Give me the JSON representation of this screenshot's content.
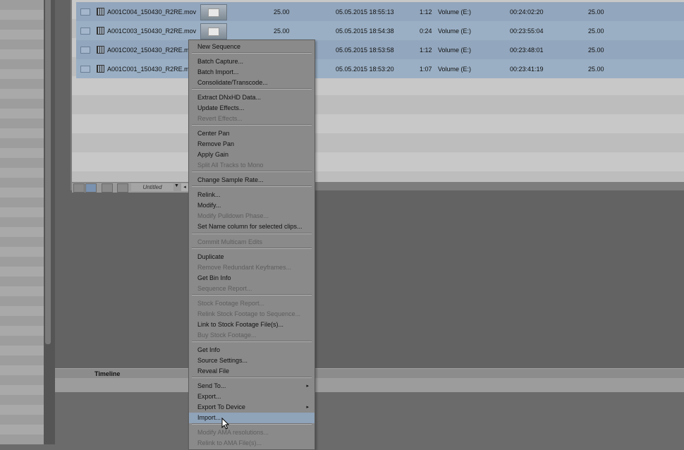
{
  "bin": {
    "rows": [
      {
        "name": "A001C004_150430_R2RE.mov",
        "fps": "25.00",
        "date": "05.05.2015 18:55:13",
        "duration": "1:12",
        "volume": "Volume (E:)",
        "tc": "00:24:02:20",
        "rate": "25.00"
      },
      {
        "name": "A001C003_150430_R2RE.mov",
        "fps": "25.00",
        "date": "05.05.2015 18:54:38",
        "duration": "0:24",
        "volume": "Volume (E:)",
        "tc": "00:23:55:04",
        "rate": "25.00"
      },
      {
        "name": "A001C002_150430_R2RE.mov",
        "fps": "25.00",
        "date": "05.05.2015 18:53:58",
        "duration": "1:12",
        "volume": "Volume (E:)",
        "tc": "00:23:48:01",
        "rate": "25.00"
      },
      {
        "name": "A001C001_150430_R2RE.mov",
        "fps": "25.00",
        "date": "05.05.2015 18:53:20",
        "duration": "1:07",
        "volume": "Volume (E:)",
        "tc": "00:23:41:19",
        "rate": "25.00"
      }
    ],
    "toolbar": {
      "view_name": "Untitled"
    }
  },
  "timeline": {
    "label": "Timeline"
  },
  "menu": {
    "items": [
      {
        "label": "New Sequence",
        "enabled": true
      },
      {
        "label": "Batch Capture...",
        "enabled": true
      },
      {
        "label": "Batch Import...",
        "enabled": true
      },
      {
        "label": "Consolidate/Transcode...",
        "enabled": true
      },
      {
        "label": "Extract DNxHD Data...",
        "enabled": true
      },
      {
        "label": "Update Effects...",
        "enabled": true
      },
      {
        "label": "Revert Effects...",
        "enabled": false
      },
      {
        "label": "Center Pan",
        "enabled": true
      },
      {
        "label": "Remove Pan",
        "enabled": true
      },
      {
        "label": "Apply Gain",
        "enabled": true
      },
      {
        "label": "Split All Tracks to Mono",
        "enabled": false
      },
      {
        "label": "Change Sample Rate...",
        "enabled": true
      },
      {
        "label": "Relink...",
        "enabled": true
      },
      {
        "label": "Modify...",
        "enabled": true
      },
      {
        "label": "Modify Pulldown Phase...",
        "enabled": false
      },
      {
        "label": "Set Name column for selected clips...",
        "enabled": true
      },
      {
        "label": "Commit Multicam Edits",
        "enabled": false
      },
      {
        "label": "Duplicate",
        "enabled": true
      },
      {
        "label": "Remove Redundant Keyframes...",
        "enabled": false
      },
      {
        "label": "Get Bin Info",
        "enabled": true
      },
      {
        "label": "Sequence Report...",
        "enabled": false
      },
      {
        "label": "Stock Footage Report...",
        "enabled": false
      },
      {
        "label": "Relink Stock Footage to Sequence...",
        "enabled": false
      },
      {
        "label": "Link to Stock Footage File(s)...",
        "enabled": true
      },
      {
        "label": "Buy Stock Footage...",
        "enabled": false
      },
      {
        "label": "Get Info",
        "enabled": true
      },
      {
        "label": "Source Settings...",
        "enabled": true
      },
      {
        "label": "Reveal File",
        "enabled": true
      },
      {
        "label": "Send To...",
        "enabled": true,
        "submenu": true
      },
      {
        "label": "Export...",
        "enabled": true
      },
      {
        "label": "Export To Device",
        "enabled": true,
        "submenu": true
      },
      {
        "label": "Import...",
        "enabled": true,
        "highlighted": true
      },
      {
        "label": "Modify AMA resolutions...",
        "enabled": false
      },
      {
        "label": "Relink to AMA File(s)...",
        "enabled": false
      }
    ]
  }
}
